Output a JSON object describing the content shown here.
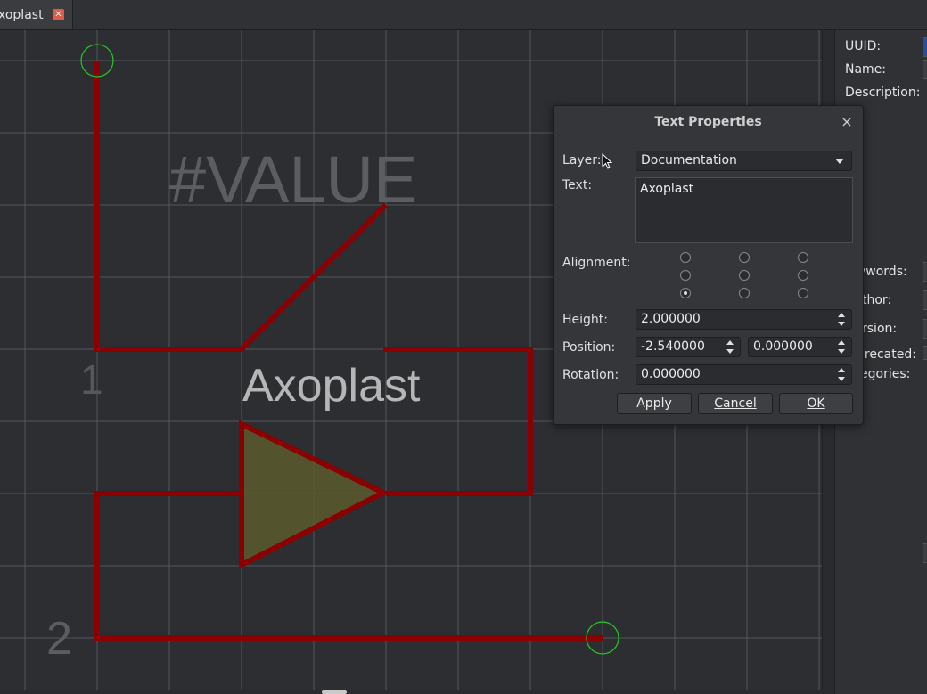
{
  "tab": {
    "label": "xoplast",
    "close_icon": "close-icon"
  },
  "canvas": {
    "value_text": "#VALUE",
    "name_text": "Axoplast",
    "pin1_label": "1",
    "pin2_label": "2",
    "colors": {
      "wire": "#8b0000",
      "grid": "#55585c",
      "origin": "#22cc22",
      "fill": "#5a5a2e"
    }
  },
  "properties": {
    "uuid_label": "UUID:",
    "name_label": "Name:",
    "description_label": "Description:",
    "keywords_label": "ywords:",
    "author_label": "thor:",
    "version_label": "rsion:",
    "deprecated_label": "precated:",
    "categories_label": "egories:"
  },
  "dialog": {
    "title": "Text Properties",
    "close": "×",
    "layer_label": "Layer:",
    "layer_value": "Documentation",
    "text_label": "Text:",
    "text_value": "Axoplast",
    "alignment_label": "Alignment:",
    "height_label": "Height:",
    "height_value": "2.000000",
    "position_label": "Position:",
    "position_x": "-2.540000",
    "position_y": "0.000000",
    "rotation_label": "Rotation:",
    "rotation_value": "0.000000",
    "apply_label": "Apply",
    "cancel_label": "Cancel",
    "ok_label": "OK"
  }
}
